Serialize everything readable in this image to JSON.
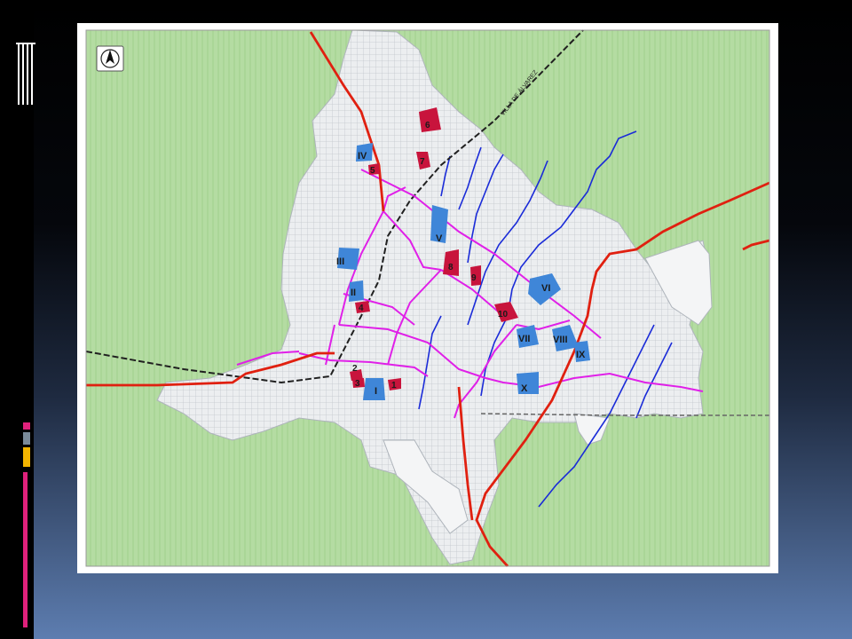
{
  "map": {
    "north_symbol": "north-arrow",
    "road_label": "VILLA DE ÁLVAREZ",
    "colors": {
      "rural": "#b4dca2",
      "urban": "#eef0f2",
      "highway": "#e02010",
      "avenue": "#e020e8",
      "railway": "#202020",
      "river": "#1a2bd8",
      "zone_blue": "#3f86d8",
      "zone_red": "#c8143c",
      "slide_accent": "#e0217c"
    },
    "blue_zones": [
      {
        "label": "I"
      },
      {
        "label": "II"
      },
      {
        "label": "III"
      },
      {
        "label": "IV"
      },
      {
        "label": "V"
      },
      {
        "label": "VI"
      },
      {
        "label": "VII"
      },
      {
        "label": "VIII"
      },
      {
        "label": "IX"
      },
      {
        "label": "X"
      }
    ],
    "red_zones": [
      {
        "label": "1"
      },
      {
        "label": "2"
      },
      {
        "label": "3"
      },
      {
        "label": "4"
      },
      {
        "label": "5"
      },
      {
        "label": "6"
      },
      {
        "label": "7"
      },
      {
        "label": "8"
      },
      {
        "label": "9"
      },
      {
        "label": "10"
      }
    ]
  }
}
